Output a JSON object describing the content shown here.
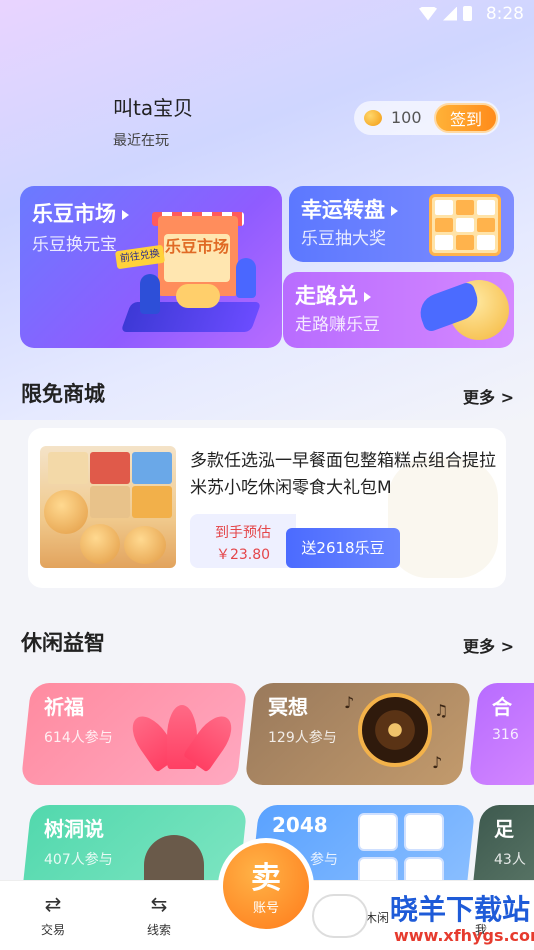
{
  "status_bar": {
    "time": "8:28"
  },
  "profile": {
    "name": "叫ta宝贝",
    "subtitle": "最近在玩",
    "coins": "100",
    "signin_label": "签到"
  },
  "feature_cards": {
    "market": {
      "title": "乐豆市场",
      "subtitle": "乐豆换元宝",
      "sign": "乐豆市场",
      "tag": "前往兑换"
    },
    "wheel": {
      "title": "幸运转盘",
      "subtitle": "乐豆抽大奖"
    },
    "walk": {
      "title": "走路兑",
      "subtitle": "走路赚乐豆"
    }
  },
  "free_mall": {
    "title": "限免商城",
    "more": "更多 >",
    "product": {
      "title": "多款任选泓一早餐面包整箱糕点组合提拉米苏小吃休闲零食大礼包M",
      "price_label": "到手预估",
      "price_value": "￥23.80",
      "bonus": "送2618乐豆"
    }
  },
  "leisure": {
    "title": "休闲益智",
    "more": "更多 >",
    "games": [
      {
        "name": "祈福",
        "players": "614人参与"
      },
      {
        "name": "冥想",
        "players": "129人参与"
      },
      {
        "name": "合",
        "players": "316"
      },
      {
        "name": "树洞说",
        "players": "407人参与"
      },
      {
        "name": "2048",
        "players": "参与"
      },
      {
        "name": "足",
        "players": "43人"
      }
    ]
  },
  "bottom_nav": {
    "trade": "交易",
    "clues": "线索",
    "sell_main": "卖",
    "sell_sub": "账号",
    "me": "我",
    "partial": "木闲"
  },
  "watermark": {
    "text": "晓羊下载站",
    "url": "www.xfhygs.com"
  },
  "colors": {
    "accent_orange": "#ff8b1a",
    "accent_blue": "#4b6bff",
    "price_red": "#e4464a"
  }
}
